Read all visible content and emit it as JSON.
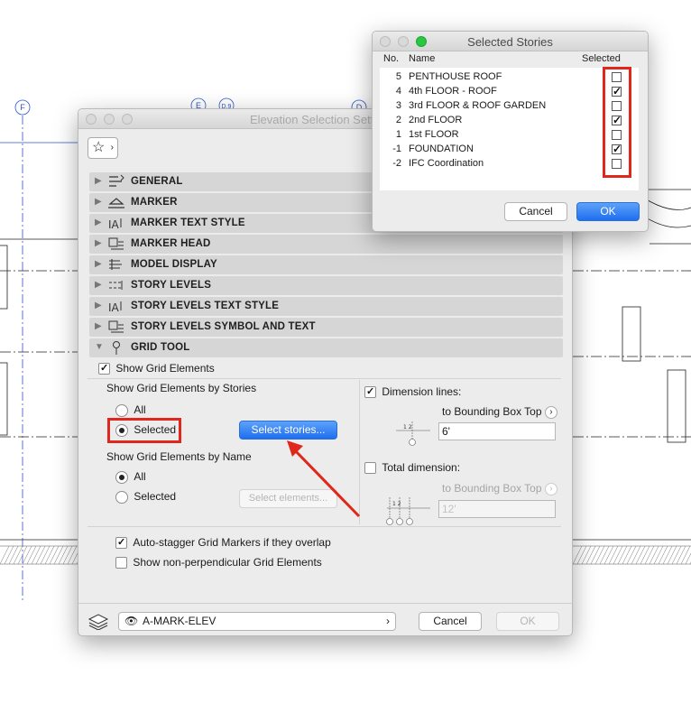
{
  "drawing": {
    "grid_markers": [
      "F",
      "E",
      "D.9",
      "D"
    ]
  },
  "elevation_dialog": {
    "title": "Elevation Selection Setti",
    "panels": [
      {
        "label": "GENERAL",
        "icon": "general-settings-icon"
      },
      {
        "label": "MARKER",
        "icon": "marker-icon"
      },
      {
        "label": "MARKER TEXT STYLE",
        "icon": "text-style-icon"
      },
      {
        "label": "MARKER HEAD",
        "icon": "marker-head-icon"
      },
      {
        "label": "MODEL DISPLAY",
        "icon": "model-display-icon"
      },
      {
        "label": "STORY LEVELS",
        "icon": "story-levels-icon"
      },
      {
        "label": "STORY LEVELS TEXT STYLE",
        "icon": "text-style-icon"
      },
      {
        "label": "STORY LEVELS SYMBOL AND TEXT",
        "icon": "symbol-icon"
      },
      {
        "label": "GRID TOOL",
        "icon": "grid-tool-icon"
      }
    ],
    "grid_tool": {
      "show_grid_elements": {
        "label": "Show Grid Elements",
        "checked": true
      },
      "by_stories": {
        "heading": "Show Grid Elements by Stories",
        "all_label": "All",
        "selected_label": "Selected",
        "value": "Selected",
        "button": "Select stories..."
      },
      "by_name": {
        "heading": "Show Grid Elements by Name",
        "all_label": "All",
        "selected_label": "Selected",
        "value": "All",
        "button": "Select elements..."
      },
      "dimension_lines": {
        "label": "Dimension lines:",
        "checked": true,
        "target": "to Bounding Box Top",
        "value": "6'",
        "diagram_label": "1 2"
      },
      "total_dimension": {
        "label": "Total dimension:",
        "checked": false,
        "target": "to Bounding Box Top",
        "value": "12'",
        "diagram_label": "1 2"
      },
      "auto_stagger": {
        "label": "Auto-stagger Grid Markers if they overlap",
        "checked": true
      },
      "non_perpendicular": {
        "label": "Show non-perpendicular Grid Elements",
        "checked": false
      }
    },
    "footer": {
      "layer": "A-MARK-ELEV",
      "cancel": "Cancel",
      "ok": "OK"
    }
  },
  "stories_dialog": {
    "title": "Selected Stories",
    "columns": {
      "no": "No.",
      "name": "Name",
      "selected": "Selected"
    },
    "rows": [
      {
        "no": "5",
        "name": "PENTHOUSE ROOF",
        "selected": false
      },
      {
        "no": "4",
        "name": "4th FLOOR - ROOF",
        "selected": true
      },
      {
        "no": "3",
        "name": "3rd FLOOR & ROOF GARDEN",
        "selected": false
      },
      {
        "no": "2",
        "name": "2nd FLOOR",
        "selected": true
      },
      {
        "no": "1",
        "name": "1st FLOOR",
        "selected": false
      },
      {
        "no": "-1",
        "name": "FOUNDATION",
        "selected": true
      },
      {
        "no": "-2",
        "name": "IFC Coordination",
        "selected": false
      }
    ],
    "cancel": "Cancel",
    "ok": "OK"
  },
  "colors": {
    "highlight_red": "#e0271b",
    "accent_blue": "#1e6ef0",
    "grid_line_blue": "#2b55c5"
  }
}
